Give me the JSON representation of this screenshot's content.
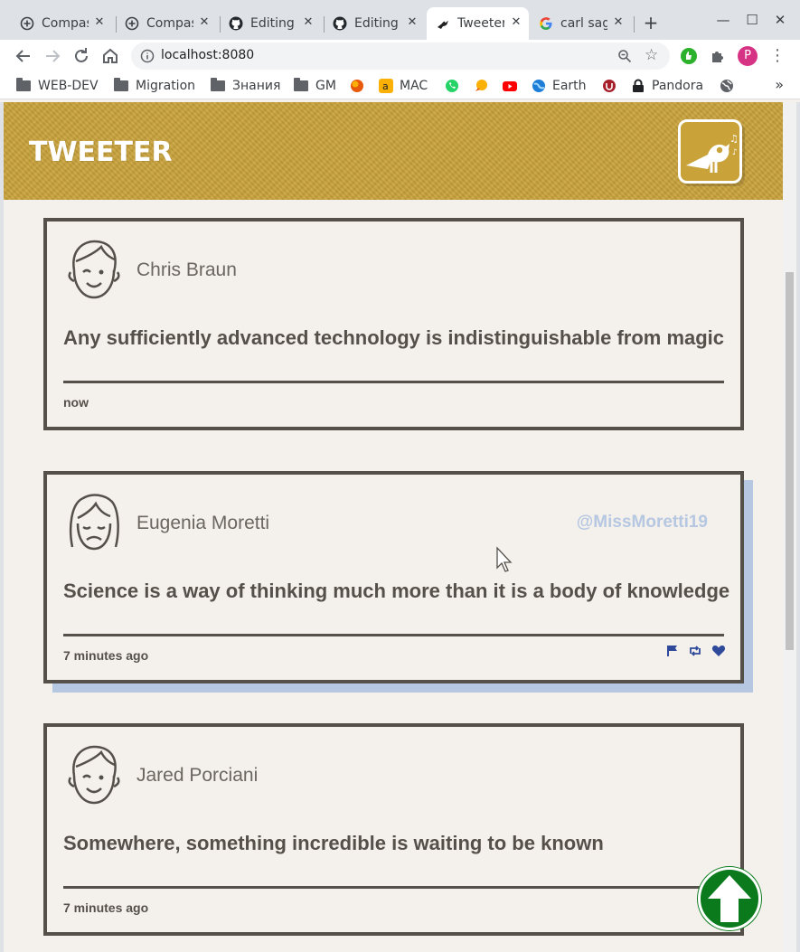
{
  "browser": {
    "tabs": [
      {
        "title": "Compass",
        "icon": "plus-circle-icon"
      },
      {
        "title": "Compass",
        "icon": "plus-circle-icon"
      },
      {
        "title": "Editing g",
        "icon": "github-icon"
      },
      {
        "title": "Editing g",
        "icon": "github-icon"
      },
      {
        "title": "Tweeter",
        "icon": "tweeter-bird-icon",
        "active": true
      },
      {
        "title": "carl sag",
        "icon": "google-icon"
      }
    ],
    "url": "localhost:8080",
    "profile_initial": "P",
    "bookmarks": [
      {
        "label": "WEB-DEV",
        "icon": "folder-icon"
      },
      {
        "label": "Migration",
        "icon": "folder-icon"
      },
      {
        "label": "Знания",
        "icon": "folder-icon"
      },
      {
        "label": "GM",
        "icon": "folder-icon"
      },
      {
        "label": "",
        "icon": "firefox-like-icon"
      },
      {
        "label": "MAC",
        "icon": "amazon-icon"
      },
      {
        "label": "",
        "icon": "whatsapp-icon"
      },
      {
        "label": "",
        "icon": "chat-bubble-icon"
      },
      {
        "label": "",
        "icon": "youtube-icon"
      },
      {
        "label": "Earth",
        "icon": "earth-icon"
      },
      {
        "label": "",
        "icon": "shield-icon"
      },
      {
        "label": "Pandora",
        "icon": "lock-icon"
      },
      {
        "label": "",
        "icon": "globe-icon"
      }
    ]
  },
  "app": {
    "brand": "TWEETER",
    "colors": {
      "header": "#c9a23a",
      "card_border": "#55504a",
      "accent": "#b6c7e2",
      "action_icons": "#2f4a9a",
      "to_top": "#0a7a1c"
    }
  },
  "tweets": [
    {
      "name": "Chris Braun",
      "handle": "",
      "content": "Any sufficiently advanced technology is indistinguishable from magic",
      "time": "now",
      "avatar": "winking-face-avatar"
    },
    {
      "name": "Eugenia Moretti",
      "handle": "@MissMoretti19",
      "content": "Science is a way of thinking much more than it is a body of knowledge",
      "time": "7 minutes ago",
      "avatar": "sad-woman-avatar",
      "actions": [
        "flag-icon",
        "retweet-icon",
        "heart-icon"
      ]
    },
    {
      "name": "Jared Porciani",
      "handle": "",
      "content": "Somewhere, something incredible is waiting to be known",
      "time": "7 minutes ago",
      "avatar": "winking-face-avatar"
    }
  ]
}
